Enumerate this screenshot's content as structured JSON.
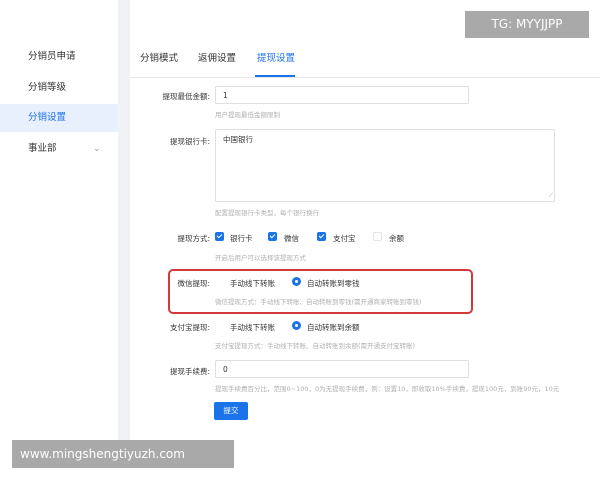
{
  "sidebar": {
    "items": [
      {
        "label": "分销员申请"
      },
      {
        "label": "分销等级"
      },
      {
        "label": "分销设置"
      },
      {
        "label": "事业部"
      }
    ]
  },
  "tabs": [
    {
      "label": "分销模式"
    },
    {
      "label": "返佣设置"
    },
    {
      "label": "提现设置"
    }
  ],
  "form": {
    "min_amount": {
      "label": "提现最低金额:",
      "value": "1",
      "hint": "用户提现最低金额限制"
    },
    "bank_card": {
      "label": "提现银行卡:",
      "value": "中国银行",
      "hint": "配置提现银行卡类型，每个银行换行"
    },
    "methods": {
      "label": "提现方式:",
      "options": [
        {
          "label": "银行卡",
          "checked": true
        },
        {
          "label": "微信",
          "checked": true
        },
        {
          "label": "支付宝",
          "checked": true
        },
        {
          "label": "余额",
          "checked": false
        }
      ],
      "hint": "开启后用户可以选择该提现方式"
    },
    "wechat": {
      "label": "微信提现:",
      "options": [
        {
          "label": "手动线下转账",
          "selected": false
        },
        {
          "label": "自动转账到零钱",
          "selected": true
        }
      ],
      "hint": "微信提现方式：手动线下转账、自动转账到零钱(需开通商家转账到零钱)"
    },
    "alipay": {
      "label": "支付宝提现:",
      "options": [
        {
          "label": "手动线下转账",
          "selected": false
        },
        {
          "label": "自动转账到余额",
          "selected": true
        }
      ],
      "hint": "支付宝提现方式：手动线下转账、自动转账到余额(需开通支付宝转账)"
    },
    "fee": {
      "label": "提现手续费:",
      "value": "0",
      "hint": "提现手续费百分比，范围0~100，0为无提现手续费，例：设置10，即收取10%手续费，提现100元，到账90元，10元"
    },
    "submit_label": "提交"
  },
  "watermarks": {
    "tag": "TG: MYYJJPP",
    "url": "www.mingshengtiyuzh.com"
  },
  "colors": {
    "accent": "#1a73e8",
    "highlight_border": "#d23a3a"
  }
}
